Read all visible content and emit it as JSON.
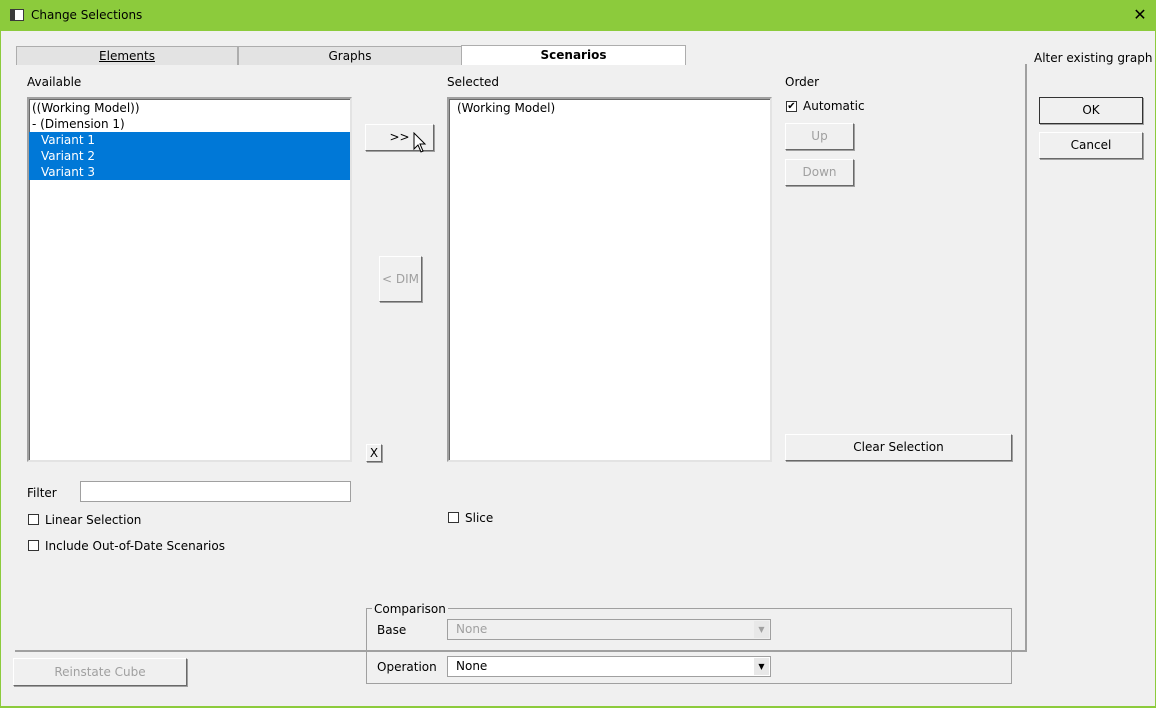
{
  "window": {
    "title": "Change Selections"
  },
  "tabs": [
    {
      "label": "Elements"
    },
    {
      "label": "Graphs"
    },
    {
      "label": "Scenarios"
    }
  ],
  "side": {
    "caption": "Alter existing graph",
    "ok_label": "OK",
    "cancel_label": "Cancel"
  },
  "available": {
    "label": "Available",
    "items": [
      {
        "text": "((Working Model))",
        "selected": false
      },
      {
        "text": "-  (Dimension 1)",
        "selected": false
      },
      {
        "text": "Variant 1",
        "selected": true
      },
      {
        "text": "Variant 2",
        "selected": true
      },
      {
        "text": "Variant 3",
        "selected": true
      }
    ]
  },
  "transfer": {
    "add_label": ">>",
    "dim_label": "< DIM",
    "x_label": "X"
  },
  "selected": {
    "label": "Selected",
    "items": [
      {
        "text": "(Working Model)"
      }
    ]
  },
  "order": {
    "label": "Order",
    "automatic_label": "Automatic",
    "automatic_checked": true,
    "up_label": "Up",
    "down_label": "Down",
    "clear_label": "Clear Selection"
  },
  "filter": {
    "label": "Filter",
    "value": ""
  },
  "options": {
    "linear_selection_label": "Linear Selection",
    "include_out_of_date_label": "Include Out-of-Date Scenarios",
    "slice_label": "Slice"
  },
  "comparison": {
    "legend": "Comparison",
    "base_label": "Base",
    "base_value": "None",
    "operation_label": "Operation",
    "operation_value": "None"
  },
  "footer": {
    "reinstate_label": "Reinstate Cube"
  }
}
